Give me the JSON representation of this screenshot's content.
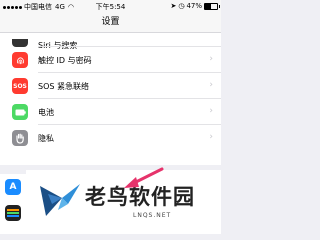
{
  "status_bar": {
    "carrier": "中国电信",
    "network": "4G",
    "time": "下午5:54",
    "battery_text": "47%",
    "battery_level": 0.47
  },
  "nav": {
    "title": "设置"
  },
  "settings": [
    {
      "label": "Siri 与搜索",
      "icon": "siri-icon",
      "color": "#333333"
    },
    {
      "label": "触控 ID 与密码",
      "icon": "fingerprint-icon",
      "color": "#ff3b30"
    },
    {
      "label": "SOS 紧急联络",
      "icon": "sos-icon",
      "color": "#ff3b30",
      "icon_text": "SOS"
    },
    {
      "label": "电池",
      "icon": "battery-icon",
      "color": "#4cd964"
    },
    {
      "label": "隐私",
      "icon": "hand-icon",
      "color": "#8e8e93"
    }
  ],
  "watermark": {
    "title": "老鸟软件园",
    "subtitle": "LNQS.NET"
  },
  "colors": {
    "accent_arrow": "#e6336b",
    "app_store_blue": "#1a8cff",
    "wallet_dark": "#222222"
  }
}
